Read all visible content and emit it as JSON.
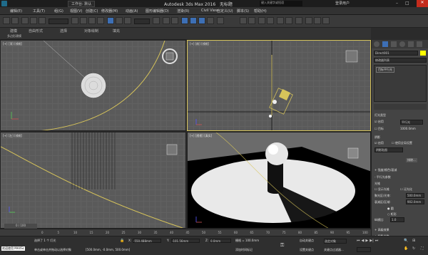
{
  "title_bar": {
    "app_title": "Autodesk 3ds Max 2016",
    "file_name": "无标题",
    "workspace_label": "工作台: 默认",
    "search_placeholder": "键入关键字或短语",
    "user_label": "登录用户"
  },
  "menu": [
    "编辑(E)",
    "工具(T)",
    "组(G)",
    "视图(V)",
    "创建(C)",
    "修改器(M)",
    "动画(A)",
    "图形编辑器(D)",
    "渲染(R)",
    "Civil View",
    "自定义(U)",
    "脚本(S)",
    "帮助(H)"
  ],
  "ribbon": {
    "tabs": [
      "建模",
      "自由形式",
      "选择",
      "对象绘制",
      "填充"
    ],
    "sub_label": "多边形建模"
  },
  "viewports": {
    "top_left": "[+] [顶] [线框]",
    "top_right": "[+] [前] [线框]",
    "bottom_left": "[+] [左] [线框]",
    "bottom_right": "[+] [透视] [真实]",
    "timeline_counter": "0 / 100"
  },
  "command_panel": {
    "object_name": "Direct001",
    "modifier_list_label": "修改器列表",
    "stack_item": "目标平行光",
    "sections": {
      "light_type": "灯光类型",
      "enable": "启用",
      "type_value": "平行光",
      "target": "目标",
      "target_dist": "1000.0mm",
      "shadows": "阴影",
      "shadow_enable": "启用",
      "use_global": "使用全局设置",
      "shadow_map": "阴影贴图",
      "exclude": "排除...",
      "intensity_color": "强度/颜色/衰减",
      "directional_params": "平行光参数",
      "light_cone": "光锥",
      "show_cone": "显示光锥",
      "overshoot": "泛光化",
      "hotspot_label": "聚光区/光束:",
      "hotspot_value": "500.0mm",
      "falloff_label": "衰减区/区域:",
      "falloff_value": "902.0mm",
      "circle": "圆",
      "rectangle": "矩形",
      "aspect_label": "纵横比:",
      "aspect_value": "1.0",
      "advanced_effects": "高级效果",
      "shadow_params": "阴影参数"
    }
  },
  "status": {
    "selection_info": "选择了 1 个 灯光",
    "hint": "单击或单击并拖动以选择对象",
    "welcome": "欢迎使用 MAXSc",
    "x_label": "X:",
    "x_value": "-550.488mm",
    "y_label": "Y:",
    "y_value": "-101.56mm",
    "z_label": "Z:",
    "z_value": "0.0mm",
    "grid_label": "栅格 = 100.0mm",
    "autokey": "自动关键点",
    "setkey": "设置关键点",
    "selected_dropdown": "选定对象",
    "key_filter": "关键点过滤器...",
    "add_time_tag": "添加时间标记",
    "coords_text": "[500.0mm, -0.0mm, 500.0mm]"
  },
  "timeline_ticks": [
    "0",
    "5",
    "10",
    "15",
    "20",
    "25",
    "30",
    "35",
    "40",
    "45",
    "50",
    "55",
    "60",
    "65",
    "70",
    "75",
    "80",
    "85",
    "90",
    "95",
    "100"
  ],
  "colors": {
    "accent_blue": "#3d6fb5",
    "selection_yellow": "#d7c45a",
    "viewport_gray": "#5a5a5a",
    "bright_white": "#ffffff"
  }
}
